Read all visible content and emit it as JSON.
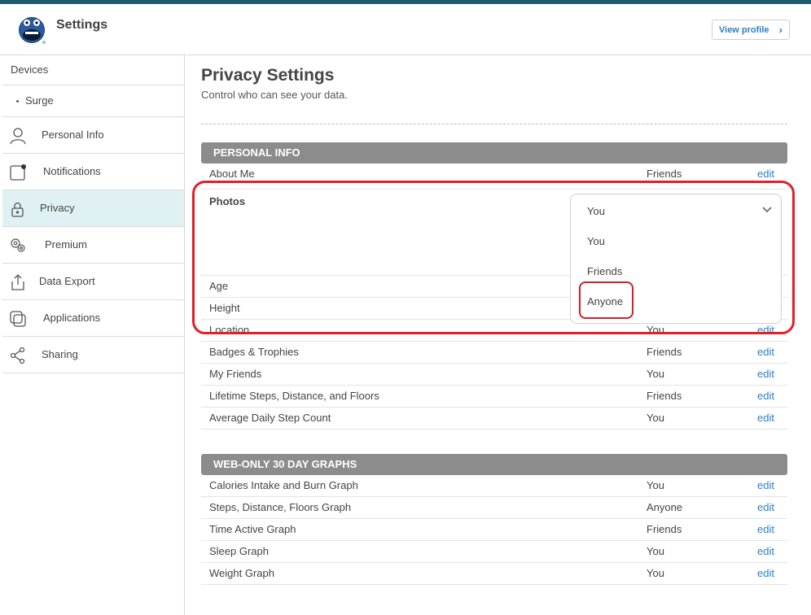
{
  "header": {
    "title": "Settings",
    "view_profile": "View profile"
  },
  "sidebar": {
    "devices": "Devices",
    "device_items": [
      "Surge"
    ],
    "items": [
      {
        "label": "Personal Info",
        "icon": "person-icon"
      },
      {
        "label": "Notifications",
        "icon": "notification-icon"
      },
      {
        "label": "Privacy",
        "icon": "lock-icon",
        "active": true
      },
      {
        "label": "Premium",
        "icon": "premium-icon"
      },
      {
        "label": "Data Export",
        "icon": "export-icon"
      },
      {
        "label": "Applications",
        "icon": "applications-icon"
      },
      {
        "label": "Sharing",
        "icon": "share-icon"
      }
    ]
  },
  "main": {
    "title": "Privacy Settings",
    "subtitle": "Control who can see your data.",
    "personal_info": {
      "header": "PERSONAL INFO",
      "rows": [
        {
          "label": "About Me",
          "value": "Friends",
          "edit": "edit"
        },
        {
          "label": "Photos"
        },
        {
          "label": "Age"
        },
        {
          "label": "Height"
        },
        {
          "label": "Location",
          "value": "You",
          "edit": "edit"
        },
        {
          "label": "Badges & Trophies",
          "value": "Friends",
          "edit": "edit"
        },
        {
          "label": "My Friends",
          "value": "You",
          "edit": "edit"
        },
        {
          "label": "Lifetime Steps, Distance, and Floors",
          "value": "Friends",
          "edit": "edit"
        },
        {
          "label": "Average Daily Step Count",
          "value": "You",
          "edit": "edit"
        }
      ]
    },
    "dropdown": {
      "selected": "You",
      "options": [
        "You",
        "Friends",
        "Anyone"
      ]
    },
    "graphs": {
      "header": "WEB-ONLY 30 DAY GRAPHS",
      "rows": [
        {
          "label": "Calories Intake and Burn Graph",
          "value": "You",
          "edit": "edit"
        },
        {
          "label": "Steps, Distance, Floors Graph",
          "value": "Anyone",
          "edit": "edit"
        },
        {
          "label": "Time Active Graph",
          "value": "Friends",
          "edit": "edit"
        },
        {
          "label": "Sleep Graph",
          "value": "You",
          "edit": "edit"
        },
        {
          "label": "Weight Graph",
          "value": "You",
          "edit": "edit"
        }
      ]
    }
  },
  "colors": {
    "accent": "#2b7fc3",
    "section_bar": "#8c8c8c",
    "active_sidebar": "#dff1f3",
    "highlight": "#e0202a"
  }
}
